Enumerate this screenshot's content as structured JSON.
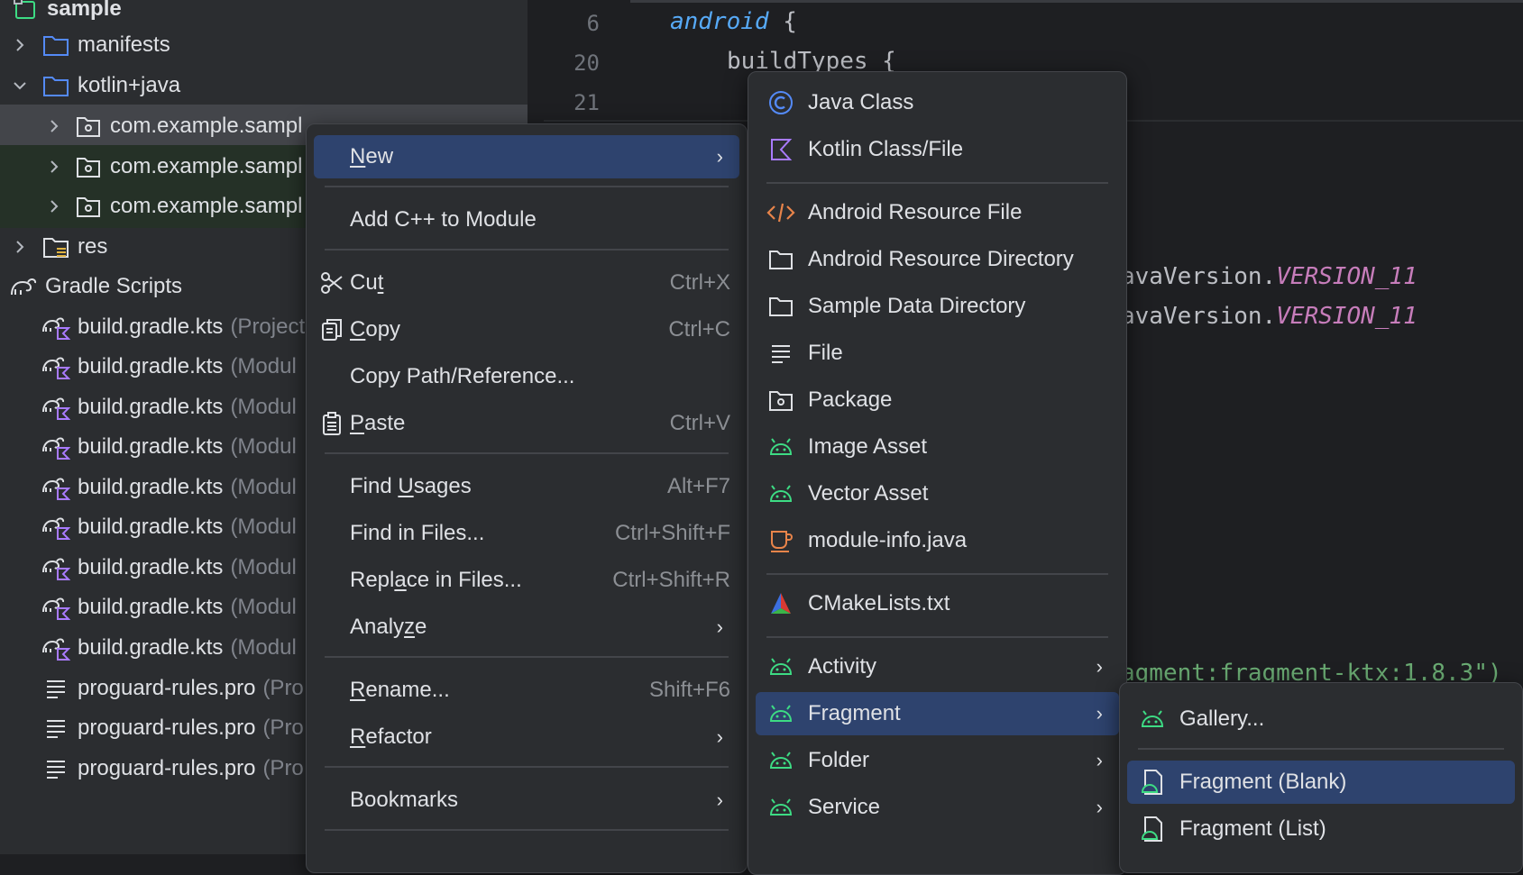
{
  "tree": {
    "root": "sample",
    "items": [
      {
        "label": "manifests",
        "expanded": false
      },
      {
        "label": "kotlin+java",
        "expanded": true
      },
      {
        "label": "com.example.sampl"
      },
      {
        "label": "com.example.sampl"
      },
      {
        "label": "com.example.sampl"
      },
      {
        "label": "res"
      },
      {
        "label": "Gradle Scripts"
      },
      {
        "label": "build.gradle.kts",
        "hint": "(Project"
      },
      {
        "label": "build.gradle.kts",
        "hint": "(Modul"
      },
      {
        "label": "build.gradle.kts",
        "hint": "(Modul"
      },
      {
        "label": "build.gradle.kts",
        "hint": "(Modul"
      },
      {
        "label": "build.gradle.kts",
        "hint": "(Modul"
      },
      {
        "label": "build.gradle.kts",
        "hint": "(Modul"
      },
      {
        "label": "build.gradle.kts",
        "hint": "(Modul"
      },
      {
        "label": "build.gradle.kts",
        "hint": "(Modul"
      },
      {
        "label": "build.gradle.kts",
        "hint": "(Modul"
      },
      {
        "label": "proguard-rules.pro",
        "hint": "(Pro"
      },
      {
        "label": "proguard-rules.pro",
        "hint": "(Pro"
      },
      {
        "label": "proguard-rules.pro",
        "hint": "(Pro"
      }
    ]
  },
  "editor": {
    "line_numbers": [
      "6",
      "20",
      "21"
    ],
    "lines": {
      "l1_kw": "android",
      "l1_rest": " {",
      "l2": "buildTypes {",
      "l3_a": "avaVersion.",
      "l3_b": "VERSION_11",
      "l4_a": "avaVersion.",
      "l4_b": "VERSION_11",
      "l5": "agment:fragment-ktx:1.8.3\")"
    }
  },
  "context_menu": {
    "new": {
      "pre": "",
      "u": "N",
      "post": "ew"
    },
    "add_cpp": "Add C++ to Module",
    "cut": {
      "pre": "Cu",
      "u": "t",
      "post": "",
      "shortcut": "Ctrl+X"
    },
    "copy": {
      "pre": "",
      "u": "C",
      "post": "opy",
      "shortcut": "Ctrl+C"
    },
    "copy_path": "Copy Path/Reference...",
    "paste": {
      "pre": "",
      "u": "P",
      "post": "aste",
      "shortcut": "Ctrl+V"
    },
    "find_usages": {
      "pre": "Find ",
      "u": "U",
      "post": "sages",
      "shortcut": "Alt+F7"
    },
    "find_in_files": {
      "label": "Find in Files...",
      "shortcut": "Ctrl+Shift+F"
    },
    "replace_in_files": {
      "pre": "Repl",
      "u": "a",
      "post": "ce in Files...",
      "shortcut": "Ctrl+Shift+R"
    },
    "analyze": {
      "pre": "Analy",
      "u": "z",
      "post": "e"
    },
    "rename": {
      "pre": "",
      "u": "R",
      "post": "ename...",
      "shortcut": "Shift+F6"
    },
    "refactor": {
      "pre": "",
      "u": "R",
      "post": "efactor"
    },
    "bookmarks": "Bookmarks"
  },
  "new_submenu": {
    "items": [
      "Java Class",
      "Kotlin Class/File",
      "Android Resource File",
      "Android Resource Directory",
      "Sample Data Directory",
      "File",
      "Package",
      "Image Asset",
      "Vector Asset",
      "module-info.java",
      "CMakeLists.txt",
      "Activity",
      "Fragment",
      "Folder",
      "Service"
    ]
  },
  "fragment_submenu": {
    "items": [
      "Gallery...",
      "Fragment (Blank)",
      "Fragment (List)"
    ]
  },
  "colors": {
    "selection": "#2e436e",
    "android_green": "#3ddc84",
    "kotlin_purple": "#a97bff",
    "java_blue": "#548af7",
    "orange": "#e8844a"
  }
}
